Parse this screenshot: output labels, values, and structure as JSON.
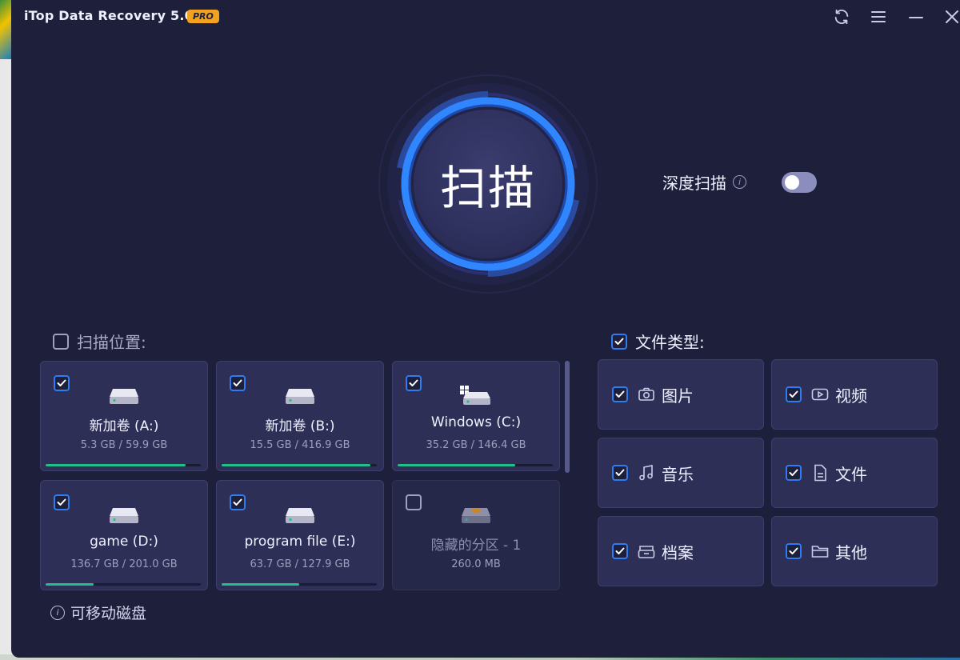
{
  "app": {
    "title": "iTop Data Recovery 5.0",
    "badge": "PRO"
  },
  "colors": {
    "window_bg": "#1d1f3b",
    "card_bg": "#2d2f57",
    "accent_blue": "#2f7cf0",
    "usage_bar": "#21c08b",
    "pro_badge": "#f3a21f"
  },
  "window_controls": [
    {
      "name": "refresh",
      "icon": "refresh-icon"
    },
    {
      "name": "menu",
      "icon": "hamburger-menu-icon"
    },
    {
      "name": "minimize",
      "icon": "minimize-icon"
    },
    {
      "name": "close",
      "icon": "close-icon"
    }
  ],
  "scan": {
    "button_label": "扫描"
  },
  "deep_scan": {
    "label": "深度扫描",
    "enabled": false
  },
  "scan_location": {
    "label": "扫描位置:",
    "checked": false,
    "drives": [
      {
        "name": "新加卷 (A:)",
        "size": "5.3 GB / 59.9 GB",
        "checked": true,
        "usage": 0.9,
        "icon": "hard-drive-icon"
      },
      {
        "name": "新加卷 (B:)",
        "size": "15.5 GB / 416.9 GB",
        "checked": true,
        "usage": 0.96,
        "icon": "hard-drive-icon"
      },
      {
        "name": "Windows (C:)",
        "size": "35.2 GB / 146.4 GB",
        "checked": true,
        "usage": 0.76,
        "icon": "windows-drive-icon"
      },
      {
        "name": "game (D:)",
        "size": "136.7 GB / 201.0 GB",
        "checked": true,
        "usage": 0.31,
        "icon": "hard-drive-icon"
      },
      {
        "name": "program file (E:)",
        "size": "63.7 GB / 127.9 GB",
        "checked": true,
        "usage": 0.5,
        "icon": "hard-drive-icon"
      },
      {
        "name": "隐藏的分区 - 1",
        "size": "260.0 MB",
        "checked": false,
        "usage": null,
        "icon": "hidden-partition-icon"
      }
    ],
    "removable_label": "可移动磁盘"
  },
  "file_types": {
    "label": "文件类型:",
    "checked": true,
    "items": [
      {
        "label": "图片",
        "icon": "camera-icon",
        "checked": true
      },
      {
        "label": "视频",
        "icon": "video-icon",
        "checked": true
      },
      {
        "label": "音乐",
        "icon": "music-note-icon",
        "checked": true
      },
      {
        "label": "文件",
        "icon": "document-icon",
        "checked": true
      },
      {
        "label": "档案",
        "icon": "archive-icon",
        "checked": true
      },
      {
        "label": "其他",
        "icon": "folder-icon",
        "checked": true
      }
    ]
  }
}
